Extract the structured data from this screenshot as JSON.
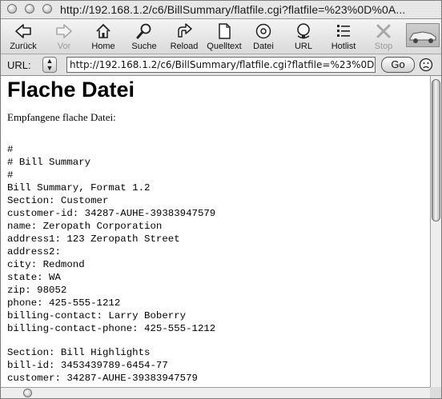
{
  "window": {
    "title": "http://192.168.1.2/c6/BillSummary/flatfile.cgi?flatfile=%23%0D%0A..."
  },
  "toolbar": {
    "buttons": [
      {
        "label": "Zurück",
        "icon": "back-arrow-icon",
        "enabled": true
      },
      {
        "label": "Vor",
        "icon": "forward-arrow-icon",
        "enabled": false
      },
      {
        "label": "Home",
        "icon": "home-icon",
        "enabled": true
      },
      {
        "label": "Suche",
        "icon": "magnifier-icon",
        "enabled": true
      },
      {
        "label": "Reload",
        "icon": "reload-icon",
        "enabled": true
      },
      {
        "label": "Quelltext",
        "icon": "page-icon",
        "enabled": true
      },
      {
        "label": "Datei",
        "icon": "disc-icon",
        "enabled": true
      },
      {
        "label": "URL",
        "icon": "url-icon",
        "enabled": true
      },
      {
        "label": "Hotlist",
        "icon": "list-icon",
        "enabled": true
      },
      {
        "label": "Stop",
        "icon": "stop-icon",
        "enabled": false
      }
    ]
  },
  "urlbar": {
    "label": "URL:",
    "value": "http://192.168.1.2/c6/BillSummary/flatfile.cgi?flatfile=%23%0D%0",
    "go_label": "Go"
  },
  "page": {
    "title": "Flache Datei",
    "intro": "Empfangene flache Datei:",
    "flatfile_lines": [
      "#",
      "# Bill Summary",
      "#",
      "Bill Summary, Format 1.2",
      "Section: Customer",
      "customer-id: 34287-AUHE-39383947579",
      "name: Zeropath Corporation",
      "address1: 123 Zeropath Street",
      "address2:",
      "city: Redmond",
      "state: WA",
      "zip: 98052",
      "phone: 425-555-1212",
      "billing-contact: Larry Boberry",
      "billing-contact-phone: 425-555-1212",
      "",
      "Section: Bill Highlights",
      "bill-id: 3453439789-6454-77",
      "customer: 34287-AUHE-39383947579"
    ]
  },
  "colors": {
    "chrome": "#dcdcdc",
    "content_bg": "#ffffff",
    "text": "#000000"
  }
}
